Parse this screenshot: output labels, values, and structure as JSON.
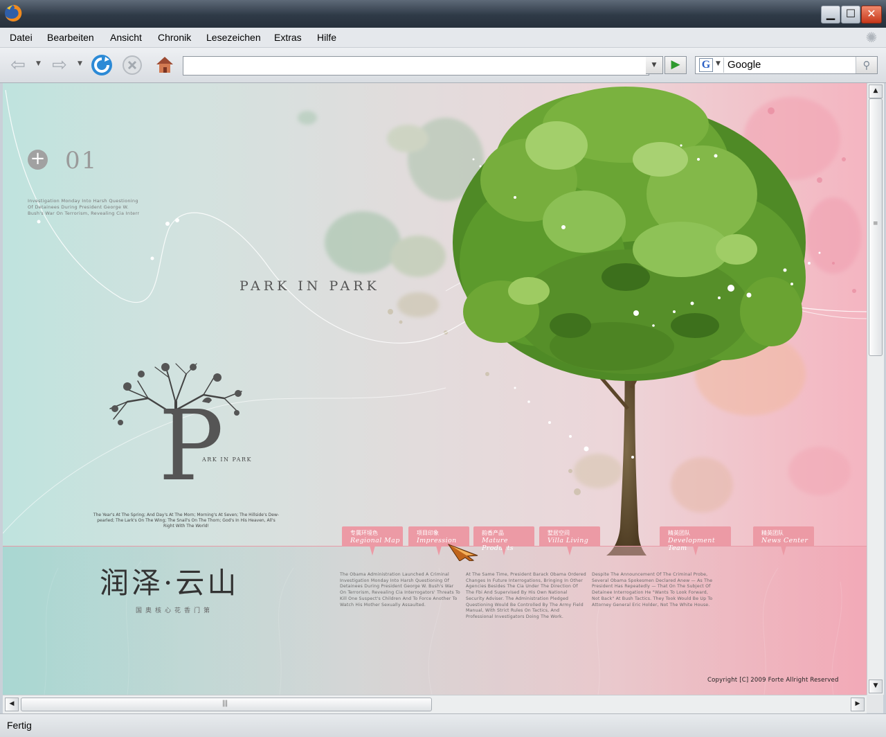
{
  "window": {
    "minimize": "▁",
    "maximize": "☐",
    "close": "✕"
  },
  "menu": [
    "Datei",
    "Bearbeiten",
    "Ansicht",
    "Chronik",
    "Lesezeichen",
    "Extras",
    "Hilfe"
  ],
  "toolbar": {
    "url_value": "",
    "search_engine": "Google",
    "search_value": "Google"
  },
  "status": {
    "text": "Fertig"
  },
  "page": {
    "number": "01",
    "intro": "Investigation Monday Into Harsh Questioning Of Detainees During President George W. Bush's War On Terrorism, Revealing Cia Interr",
    "headline": "PARK IN PARK",
    "logo_small": "ARK IN PARK",
    "poem": "The Year's At The Spring; And Day's At The Morn; Morning's At Seven; The Hillside's Dew-pearled; The Lark's On The Wing; The Snail's On The Thorn; God's In His Heaven, All's Right With The World!",
    "brand_cn": "润泽·云山",
    "brand_sub": "国奥核心花香门第",
    "tabs": [
      {
        "cn": "专属环境色",
        "en": "Regional Map"
      },
      {
        "cn": "项目印象",
        "en": "Impression"
      },
      {
        "cn": "韵香产品",
        "en": "Mature Products"
      },
      {
        "cn": "墅居空间",
        "en": "Villa Living"
      },
      {
        "cn": "精英团队",
        "en": "Development Team"
      },
      {
        "cn": "精英团队",
        "en": "News Center"
      }
    ],
    "columns": [
      "The Obama Administration Launched A Criminal Investigation Monday Into Harsh Questioning Of Detainees During President George W. Bush's War On Terrorism, Revealing Cia Interrogators' Threats To Kill One Suspect's Children And To Force Another To Watch His Mother Sexually Assaulted.",
      "At The Same Time, President Barack Obama Ordered Changes In Future Interrogations, Bringing In Other Agencies Besides The Cia Under The Direction Of The Fbi And Supervised By His Own National Security Adviser. The Administration Pledged Questioning Would Be Controlled By The Army Field Manual, With Strict Rules On Tactics, And Professional Investigators Doing The Work.",
      "Despite The Announcement Of The Criminal Probe, Several Obama Spokesmen Declared Anew — As The President Has Repeatedly — That On The Subject Of Detainee Interrogation He \"Wants To Look Forward, Not Back\" At Bush Tactics. They Took Would Be Up To Attorney General Eric Holder, Not The White House."
    ],
    "copyright": "Copyright  [C] 2009 Forte Allright Reserved"
  },
  "colors": {
    "tab": "#ec9aa5",
    "tree_green": "#5e9a2c",
    "accent_pink": "#f2b6c1",
    "accent_mint": "#bfe3de"
  }
}
